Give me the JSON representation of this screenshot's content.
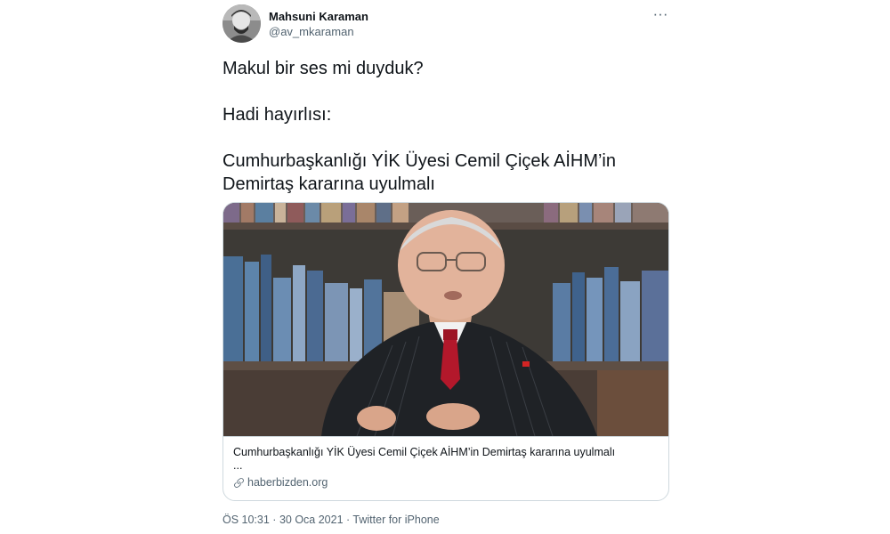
{
  "author": {
    "name": "Mahsuni Karaman",
    "handle": "@av_mkaraman",
    "avatar_icon": "user-avatar-icon"
  },
  "more_label": "···",
  "tweet": {
    "lines": [
      "Makul bir ses mi duyduk?",
      "Hadi hayırlısı:",
      "Cumhurbaşkanlığı YİK Üyesi Cemil Çiçek AİHM’in",
      "Demirtaş kararına uyulmalı"
    ]
  },
  "card": {
    "image_icon": "news-photo-image",
    "title": "Cumhurbaşkanlığı YİK Üyesi Cemil Çiçek AİHM’in Demirtaş kararına uyulmalı",
    "description": "...",
    "domain": "haberbizden.org",
    "domain_icon": "link-icon"
  },
  "meta": {
    "time": "ÖS 10:31",
    "separator": " · ",
    "date": "30 Oca 2021",
    "source": "Twitter for iPhone"
  },
  "colors": {
    "text": "#0f1419",
    "secondary": "#536471",
    "border": "#cfd9de"
  }
}
